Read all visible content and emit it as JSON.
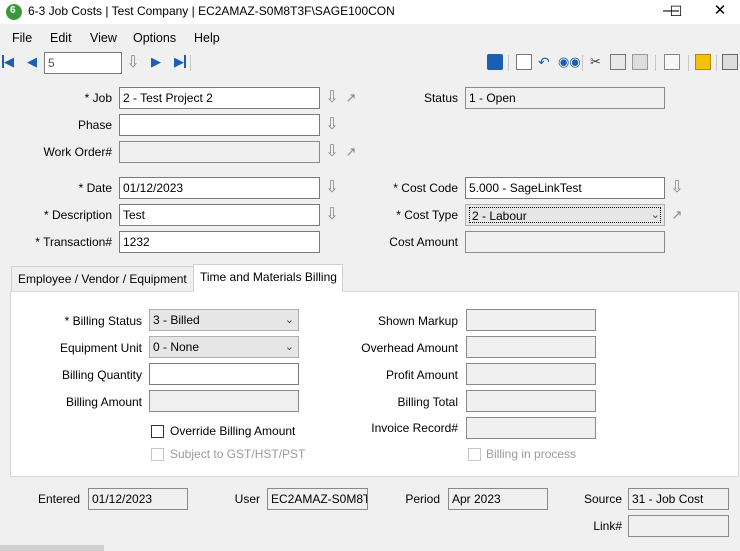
{
  "window": {
    "title": "6-3 Job Costs | Test Company | EC2AMAZ-S0M8T3F\\SAGE100CON",
    "minimize": "—",
    "maximize": "☐",
    "close": "✕"
  },
  "menu": [
    "File",
    "Edit",
    "View",
    "Options",
    "Help"
  ],
  "toolbar": {
    "record_number": "5",
    "icons": [
      "save-icon",
      "new-icon",
      "undo-icon",
      "find-icon",
      "cut-icon",
      "copy-icon",
      "paste-icon",
      "grid-icon",
      "note-icon",
      "print-icon"
    ]
  },
  "header": {
    "job_label": "* Job",
    "job_value": "2 - Test Project 2",
    "status_label": "Status",
    "status_value": "1 - Open",
    "phase_label": "Phase",
    "phase_value": "",
    "work_order_label": "Work Order#",
    "work_order_value": "",
    "date_label": "* Date",
    "date_value": "01/12/2023",
    "description_label": "* Description",
    "description_value": "Test",
    "transaction_label": "* Transaction#",
    "transaction_value": "1232",
    "cost_code_label": "* Cost Code",
    "cost_code_value": "5.000 - SageLinkTest",
    "cost_type_label": "* Cost Type",
    "cost_type_value": "2 - Labour",
    "cost_amount_label": "Cost Amount",
    "cost_amount_value": ""
  },
  "tabs": [
    "Employee / Vendor / Equipment",
    "Time and Materials Billing"
  ],
  "billing": {
    "billing_status_label": "* Billing Status",
    "billing_status_value": "3 - Billed",
    "equipment_unit_label": "Equipment Unit",
    "equipment_unit_value": "0 - None",
    "billing_quantity_label": "Billing Quantity",
    "billing_quantity_value": "",
    "billing_amount_label": "Billing Amount",
    "billing_amount_value": "",
    "override_label": "Override Billing Amount",
    "override_checked": false,
    "gst_label": "Subject to GST/HST/PST",
    "gst_checked": false,
    "shown_markup_label": "Shown Markup",
    "shown_markup_value": "",
    "overhead_amount_label": "Overhead Amount",
    "overhead_amount_value": "",
    "profit_amount_label": "Profit Amount",
    "profit_amount_value": "",
    "billing_total_label": "Billing Total",
    "billing_total_value": "",
    "invoice_record_label": "Invoice Record#",
    "invoice_record_value": "",
    "billing_in_process_label": "Billing in process",
    "billing_in_process_checked": false
  },
  "footer": {
    "entered_label": "Entered",
    "entered_value": "01/12/2023",
    "user_label": "User",
    "user_value": "EC2AMAZ-S0M8T",
    "period_label": "Period",
    "period_value": "Apr 2023",
    "source_label": "Source",
    "source_value": "31 - Job Cost",
    "link_label": "Link#",
    "link_value": ""
  },
  "colors": {
    "accent": "#1a5fb4",
    "app_icon": "#3a9a3a"
  }
}
